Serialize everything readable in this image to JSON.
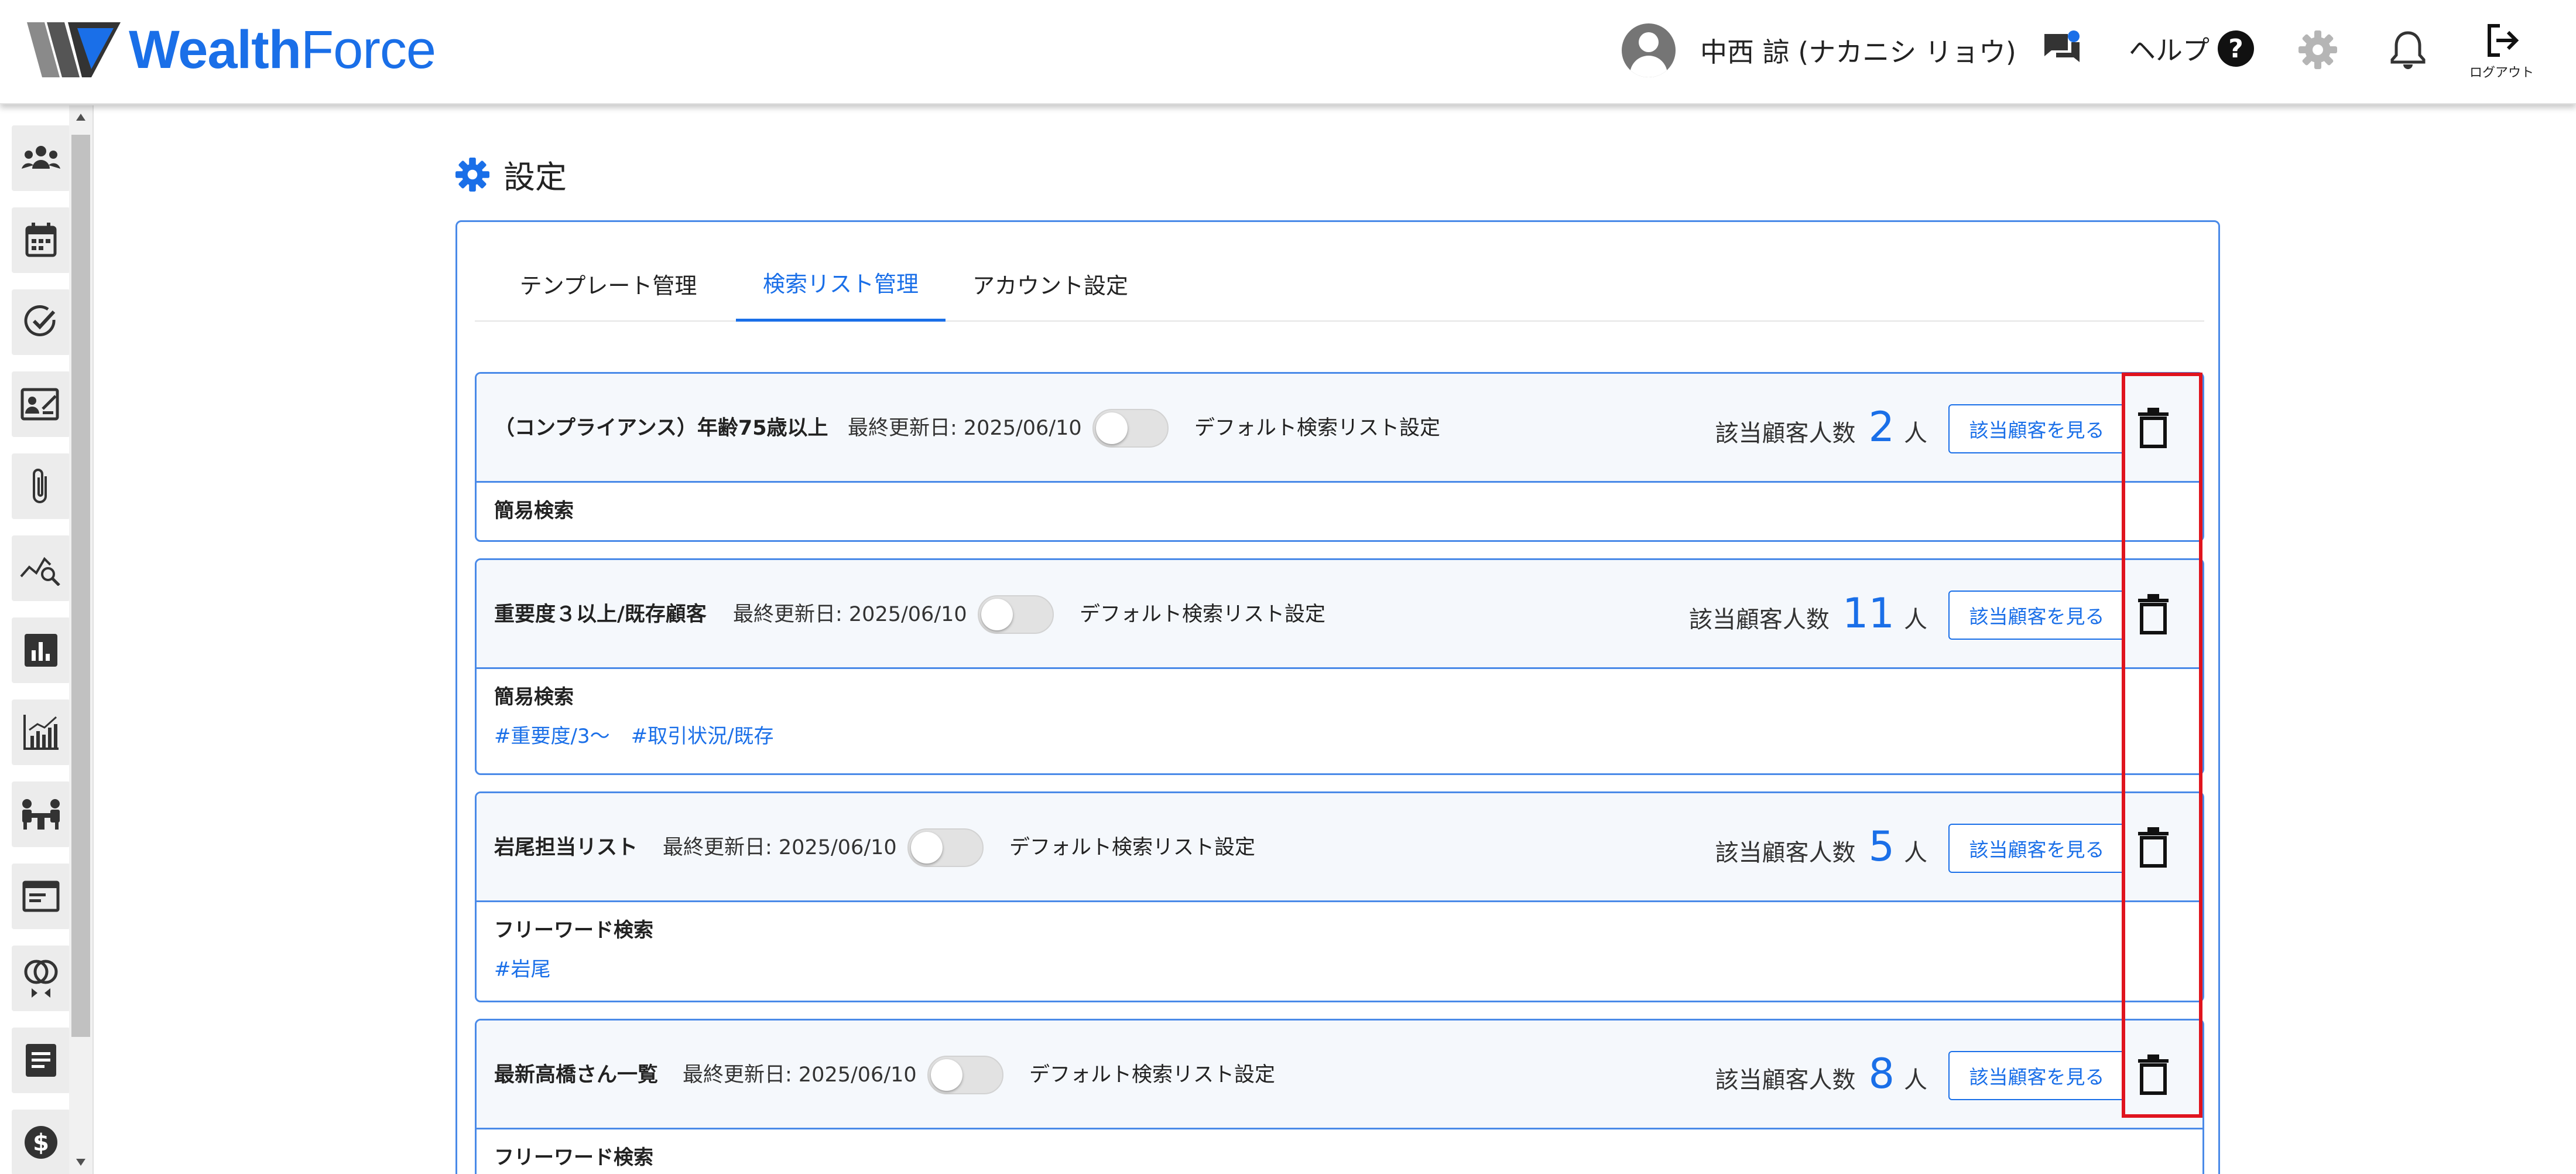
{
  "header": {
    "logo_text_bold": "Wealth",
    "logo_text_light": "Force",
    "user_name": "中西 諒 (ナカニシ リョウ)",
    "help_label": "ヘルプ",
    "help_glyph": "?",
    "logout_label": "ログアウト",
    "brand_color": "#1a6fe8",
    "notification_dot_color": "#1a6fe8"
  },
  "sidebar": {
    "items": [
      {
        "icon": "people-icon"
      },
      {
        "icon": "calendar-icon"
      },
      {
        "icon": "check-circle-icon"
      },
      {
        "icon": "id-card-icon"
      },
      {
        "icon": "paperclip-icon"
      },
      {
        "icon": "chart-search-icon"
      },
      {
        "icon": "bar-chart-icon"
      },
      {
        "icon": "growth-chart-icon"
      },
      {
        "icon": "meeting-icon"
      },
      {
        "icon": "window-icon"
      },
      {
        "icon": "rings-icon"
      },
      {
        "icon": "document-icon"
      },
      {
        "icon": "dollar-icon"
      }
    ]
  },
  "page": {
    "title": "設定",
    "tabs": [
      {
        "label": "テンプレート管理",
        "active": false
      },
      {
        "label": "検索リスト管理",
        "active": true
      },
      {
        "label": "アカウント設定",
        "active": false
      }
    ]
  },
  "lists": [
    {
      "name": "（コンプライアンス）年齢75歳以上",
      "date": "最終更新日: 2025/06/10",
      "toggle_label": "デフォルト検索リスト設定",
      "toggle_on": false,
      "count_label": "該当顧客人数",
      "count": "2",
      "unit": "人",
      "view_label": "該当顧客を見る",
      "search_type": "簡易検索",
      "tags": []
    },
    {
      "name": "重要度３以上/既存顧客",
      "date": "最終更新日: 2025/06/10",
      "toggle_label": "デフォルト検索リスト設定",
      "toggle_on": false,
      "count_label": "該当顧客人数",
      "count": "11",
      "unit": "人",
      "view_label": "該当顧客を見る",
      "search_type": "簡易検索",
      "tags": [
        "#重要度/3〜",
        "#取引状況/既存"
      ]
    },
    {
      "name": "岩尾担当リスト",
      "date": "最終更新日: 2025/06/10",
      "toggle_label": "デフォルト検索リスト設定",
      "toggle_on": false,
      "count_label": "該当顧客人数",
      "count": "5",
      "unit": "人",
      "view_label": "該当顧客を見る",
      "search_type": "フリーワード検索",
      "tags": [
        "#岩尾"
      ]
    },
    {
      "name": "最新高橋さん一覧",
      "date": "最終更新日: 2025/06/10",
      "toggle_label": "デフォルト検索リスト設定",
      "toggle_on": false,
      "count_label": "該当顧客人数",
      "count": "8",
      "unit": "人",
      "view_label": "該当顧客を見る",
      "search_type": "フリーワード検索",
      "tags": []
    }
  ],
  "highlight": {
    "color": "#e0141e"
  }
}
